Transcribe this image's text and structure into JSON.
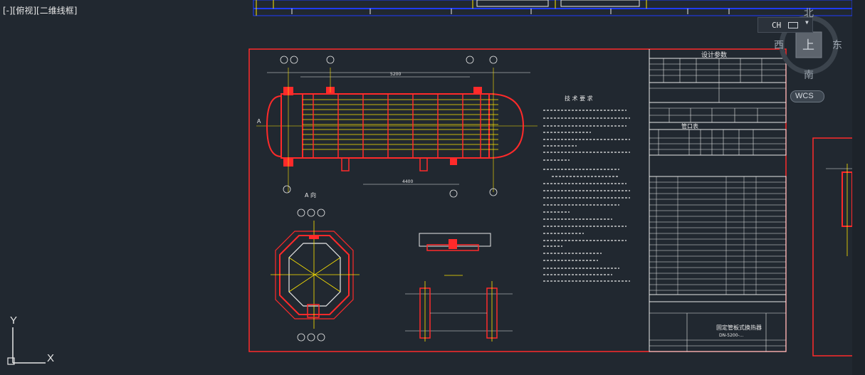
{
  "viewport": {
    "label": "[-][俯视][二维线框]"
  },
  "viewcube": {
    "north": "北",
    "south": "南",
    "east": "东",
    "west": "西",
    "face": "上"
  },
  "input_indicator": {
    "language": "CH"
  },
  "ucs_button": {
    "label": "WCS"
  },
  "ucs_icon": {
    "x_label": "X",
    "y_label": "Y"
  },
  "drawing": {
    "section_a_label": "A",
    "a_view_label": "A 向",
    "tech_requirements_title": "技 术 要 求",
    "design_params_title": "设计参数",
    "nozzle_table_title": "管口表",
    "drawing_title_line1": "固定管板式换热器",
    "drawing_title_line2": "DN-5200-...",
    "dimension_top": "5200",
    "dimension_bottom": "4400",
    "colors": {
      "background": "#212830",
      "frame_red": "#ff2a2a",
      "line_white": "#e8e8e8",
      "line_yellow": "#ffe600",
      "line_blue": "#1f3cff"
    }
  }
}
